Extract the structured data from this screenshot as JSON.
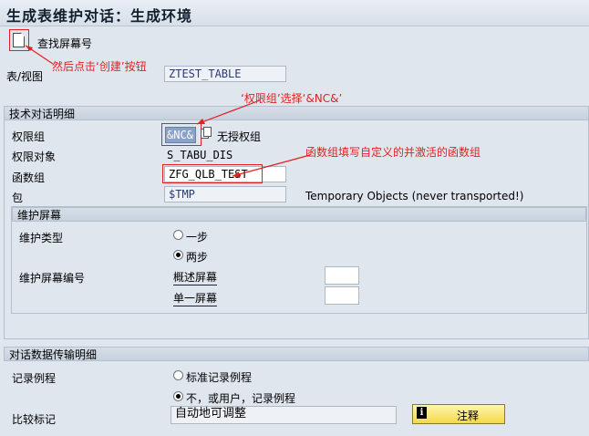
{
  "window": {
    "title": "生成表维护对话：生成环境"
  },
  "toolbar": {
    "find_screen_label": "查找屏幕号"
  },
  "annotations": {
    "create_hint": "然后点击‘创建’按钮",
    "auth_hint": "‘权限组’选择‘&NC&’",
    "fg_hint": "函数组填写自定义的并激活的函数组"
  },
  "table_view": {
    "label": "表/视图",
    "value": "ZTEST_TABLE"
  },
  "tech_details": {
    "header": "技术对话明细",
    "auth_group_label": "权限组",
    "auth_group_value": "&NC&",
    "auth_group_desc": "无授权组",
    "auth_object_label": "权限对象",
    "auth_object_value": "S_TABU_DIS",
    "function_group_label": "函数组",
    "function_group_value": "ZFG_QLB_TEST",
    "package_label": "包",
    "package_value": "$TMP",
    "package_desc": "Temporary Objects (never transported!)"
  },
  "maint_screen": {
    "header": "维护屏幕",
    "type_label": "维护类型",
    "option_one_step": "一步",
    "option_two_step": "两步",
    "selected_option": "两步",
    "screen_no_label": "维护屏幕编号",
    "overview_screen_label": "概述屏幕",
    "overview_screen_value": "",
    "single_screen_label": "单一屏幕",
    "single_screen_value": ""
  },
  "dialog_transfer": {
    "header": "对话数据传输明细",
    "record_routine_label": "记录例程",
    "option_standard": "标准记录例程",
    "option_no_or_user": "不，或用户，记录例程",
    "selected_option": "不，或用户，记录例程",
    "compare_flag_label": "比较标记",
    "compare_flag_value": "自动地可调整",
    "comment_button": "注释"
  },
  "colors": {
    "annotation_red": "#e42020",
    "field_text": "#2a3c6b"
  },
  "icons": [
    "create-document-icon",
    "value-help-icon",
    "info-icon"
  ]
}
